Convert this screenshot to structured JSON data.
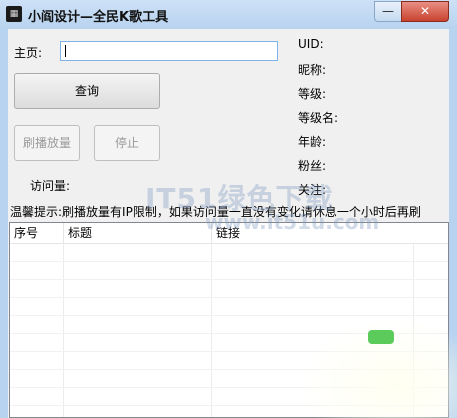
{
  "window": {
    "title": "小阎设计—全民K歌工具",
    "app_icon": "app-logo-icon",
    "minimize_glyph": "—",
    "close_glyph": "✕"
  },
  "form": {
    "home_label": "主页:",
    "home_value": "",
    "query_button": "查询",
    "boost_button": "刷播放量",
    "stop_button": "停止",
    "visits_label": "访问量:"
  },
  "info": {
    "uid_label": "UID:",
    "nickname_label": "昵称:",
    "level_label": "等级:",
    "level_name_label": "等级名:",
    "age_label": "年龄:",
    "fans_label": "粉丝:",
    "follow_label": "关注:"
  },
  "tip": "温馨提示:刷播放量有IP限制，如果访问量一直没有变化请休息一个小时后再刷",
  "table": {
    "columns": [
      "序号",
      "标题",
      "链接"
    ]
  },
  "watermark": {
    "text": "IT51绿色下载",
    "url": "www.it51u.com"
  },
  "colors": {
    "frame": "#b8d3f0",
    "close_button": "#c8432f",
    "input_border": "#7eb4ea"
  }
}
